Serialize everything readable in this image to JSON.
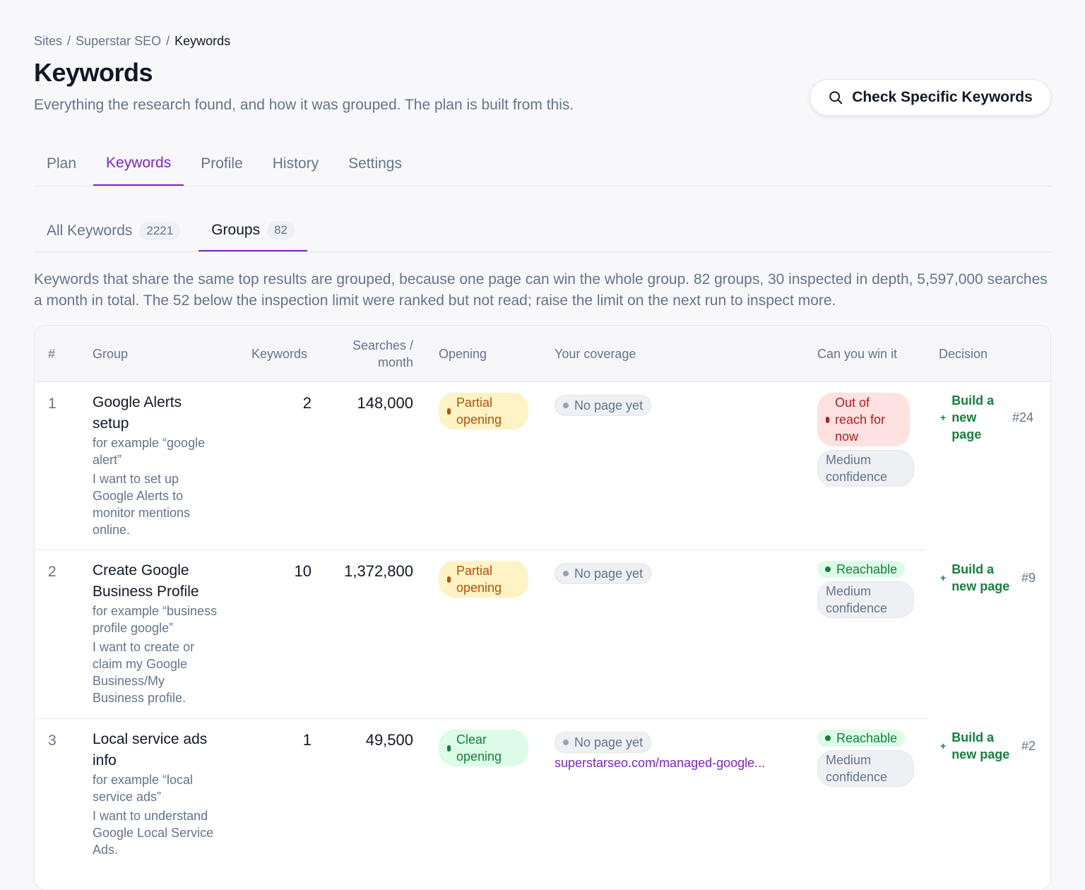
{
  "breadcrumb": [
    "Sites",
    "Superstar SEO",
    "Keywords"
  ],
  "page": {
    "title": "Keywords",
    "subtitle": "Everything the research found, and how it was grouped. The plan is built from this.",
    "check_button": "Check Specific Keywords"
  },
  "tabs": [
    "Plan",
    "Keywords",
    "Profile",
    "History",
    "Settings"
  ],
  "active_tab": "Keywords",
  "subtabs": [
    {
      "label": "All Keywords",
      "count": "2221"
    },
    {
      "label": "Groups",
      "count": "82"
    }
  ],
  "description": "Keywords that share the same top results are grouped, because one page can win the whole group. 82 groups, 30 inspected in depth, 5,597,000 searches a month in total. The 52 below the inspection limit were ranked but not read; raise the limit on the next run to inspect more.",
  "table": {
    "headers": {
      "num": "#",
      "group": "Group",
      "keywords": "Keywords",
      "searches_1": "Searches /",
      "searches_2": "month",
      "opening": "Opening",
      "coverage": "Your coverage",
      "win": "Can you win it",
      "decision": "Decision"
    },
    "rows": [
      {
        "num": "1",
        "name": "Google Alerts setup",
        "example": "for example “google alert”",
        "intent": "I want to set up Google Alerts to monitor mentions online.",
        "keywords": "2",
        "searches": "148,000",
        "opening": "Partial opening",
        "coverage": "No page yet",
        "coverage_url": "",
        "win": "Out of reach for now",
        "confidence": "Medium confidence",
        "decision": "Build a new page",
        "rank": "#24"
      },
      {
        "num": "2",
        "name": "Create Google Business Profile",
        "example": "for example “business profile google”",
        "intent": "I want to create or claim my Google Business/My Business profile.",
        "keywords": "10",
        "searches": "1,372,800",
        "opening": "Partial opening",
        "coverage": "No page yet",
        "coverage_url": "",
        "win": "Reachable",
        "confidence": "Medium confidence",
        "decision": "Build a new page",
        "rank": "#9"
      },
      {
        "num": "3",
        "name": "Local service ads info",
        "example": "for example “local service ads”",
        "intent": "I want to understand Google Local Service Ads.",
        "keywords": "1",
        "searches": "49,500",
        "opening": "Clear opening",
        "coverage": "No page yet",
        "coverage_url": "superstarseo.com/managed-google...",
        "win": "Reachable",
        "confidence": "Medium confidence",
        "decision": "Build a new page",
        "rank": "#2"
      }
    ]
  }
}
